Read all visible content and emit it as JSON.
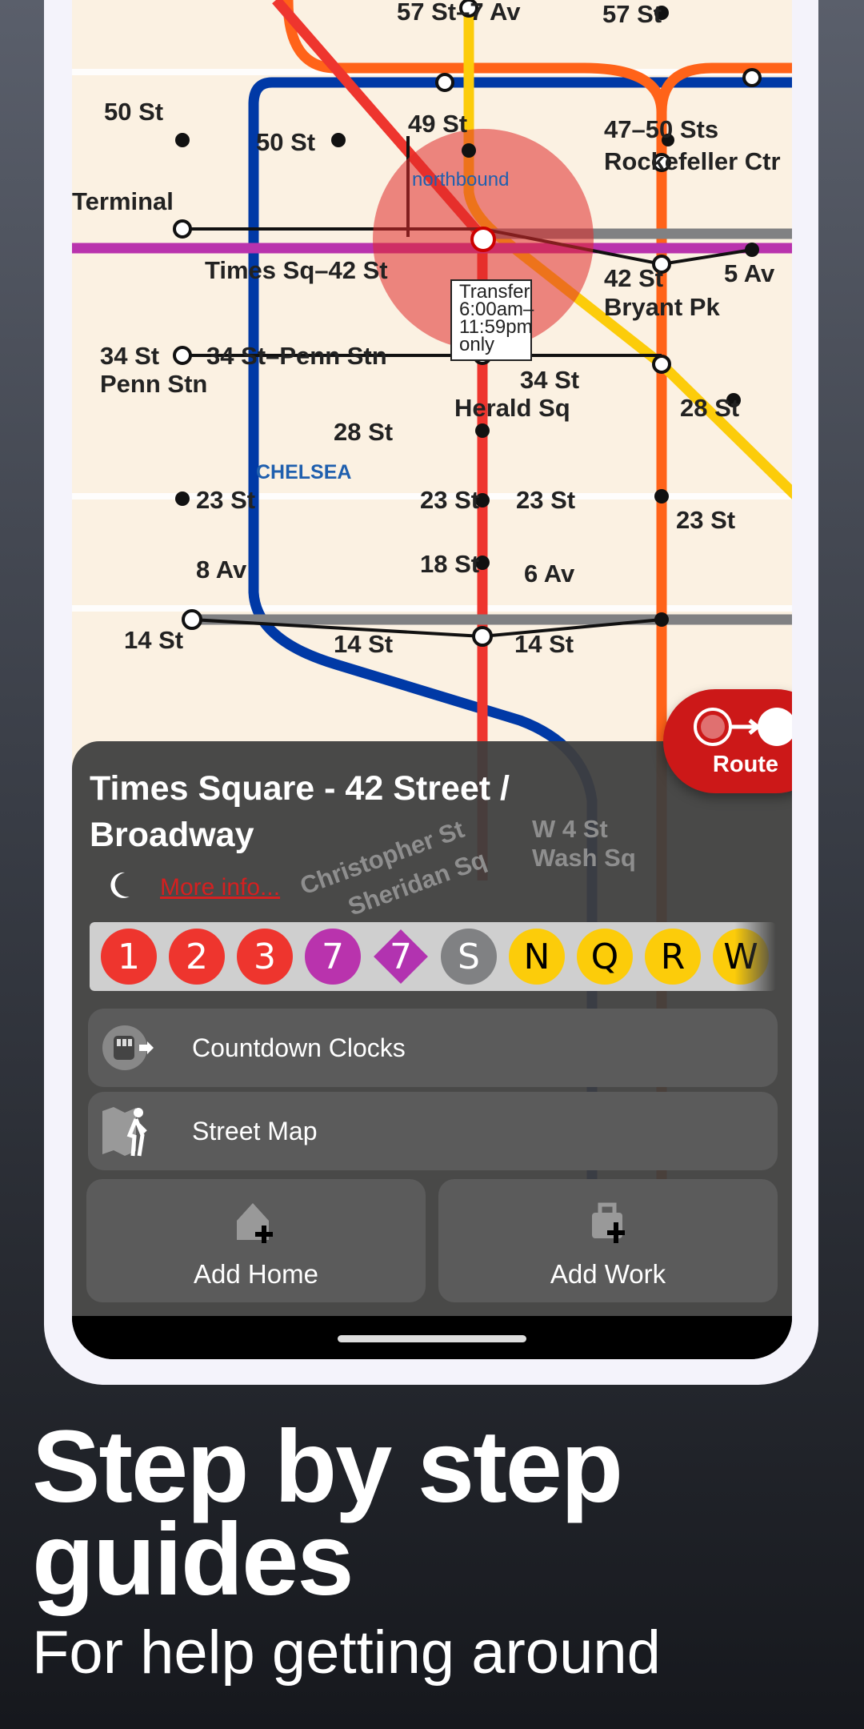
{
  "map": {
    "labels": [
      "57 St–7 Av",
      "57 St",
      "50 St",
      "50 St",
      "49 St",
      "47–50 Sts",
      "Rockefeller Ctr",
      "Times Sq–42 St",
      "42 St",
      "Bryant Pk",
      "5 Av",
      "34 St–Penn Stn",
      "34 St",
      "Penn Stn",
      "34 St",
      "Herald Sq",
      "28 St",
      "28 St",
      "23 St",
      "23 St",
      "23 St",
      "23 St",
      "18 St",
      "8 Av",
      "6 Av",
      "14 St",
      "14 St",
      "14 St",
      "CHELSEA",
      "W 4 St",
      "Wash Sq",
      "Christopher St",
      "Sheridan Sq",
      "Terminal"
    ],
    "transfer_note": [
      "Transfer",
      "6:00am–",
      "11:59pm",
      "only"
    ],
    "northbound": "northbound",
    "colors": {
      "red": "#ee352e",
      "yellow": "#fccc0a",
      "orange": "#ff6319",
      "blue": "#0039a6",
      "purple": "#b933ad",
      "gray": "#808183"
    }
  },
  "station": {
    "name": "Times Square - 42 Street / Broadway",
    "more_info": "More info...",
    "night_icon": "moon-icon",
    "lines": [
      {
        "label": "1",
        "shape": "circle",
        "color": "#ee352e",
        "text": "#ffffff"
      },
      {
        "label": "2",
        "shape": "circle",
        "color": "#ee352e",
        "text": "#ffffff"
      },
      {
        "label": "3",
        "shape": "circle",
        "color": "#ee352e",
        "text": "#ffffff"
      },
      {
        "label": "7",
        "shape": "circle",
        "color": "#b933ad",
        "text": "#ffffff"
      },
      {
        "label": "7",
        "shape": "diamond",
        "color": "#b933ad",
        "text": "#ffffff"
      },
      {
        "label": "S",
        "shape": "circle",
        "color": "#808183",
        "text": "#ffffff"
      },
      {
        "label": "N",
        "shape": "circle",
        "color": "#fccc0a",
        "text": "#000000"
      },
      {
        "label": "Q",
        "shape": "circle",
        "color": "#fccc0a",
        "text": "#000000"
      },
      {
        "label": "R",
        "shape": "circle",
        "color": "#fccc0a",
        "text": "#000000"
      },
      {
        "label": "W",
        "shape": "circle",
        "color": "#fccc0a",
        "text": "#000000"
      }
    ]
  },
  "actions": {
    "countdown": "Countdown Clocks",
    "street_map": "Street Map",
    "add_home": "Add Home",
    "add_work": "Add Work",
    "route": "Route"
  },
  "promo": {
    "headline_1": "Step by step",
    "headline_2": "guides",
    "subtitle": "For help getting around"
  }
}
